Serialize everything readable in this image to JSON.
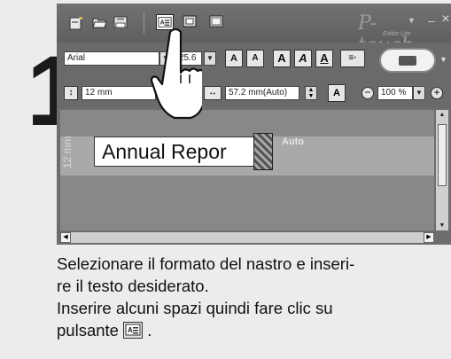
{
  "step": {
    "number": "1"
  },
  "app": {
    "logo": "P-touch",
    "logo_sub": "Editor Lite",
    "toolbar": {
      "icons": [
        "new-document-icon",
        "open-folder-icon",
        "save-icon",
        "text-layout-icon",
        "frame-icon",
        "layout-icon"
      ]
    },
    "format_bar": {
      "font": "Arial",
      "font_size": "25.6",
      "grow_font_label": "A",
      "shrink_font_label": "A",
      "bold_label": "A",
      "italic_label": "A",
      "underline_label": "A",
      "align_label": "≡·"
    },
    "size_bar": {
      "tape_width": "12 mm",
      "label_length": "57.2 mm(Auto)",
      "zoom": "100 %",
      "zoom_out_label": "−",
      "zoom_in_label": "+"
    },
    "canvas": {
      "tape_width_label": "12 mm",
      "text": "Annual Repor",
      "auto_label": "Auto"
    },
    "window_controls": {
      "minimize": "–",
      "close": "×"
    }
  },
  "instructions": {
    "line1": "Selezionare il formato del nastro e inseri-",
    "line2": "re il testo desiderato.",
    "line3": "Inserire alcuni spazi quindi fare clic su",
    "line4_prefix": "pulsante",
    "line4_suffix": "."
  },
  "colors": {
    "toolbar_bg": "#6a6a6a",
    "canvas_bg": "#888888",
    "tape_bg": "#a9a9a9",
    "page_bg": "#ececec"
  }
}
